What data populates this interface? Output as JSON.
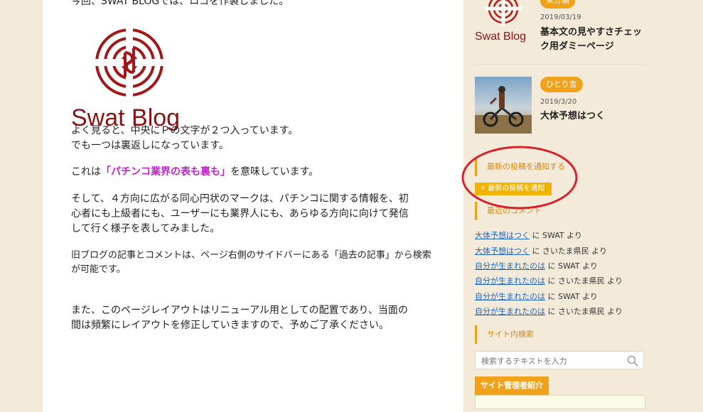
{
  "article": {
    "intro": "今回、SWAT BLOGでは、ロゴを作製しました。",
    "logo_text": "Swat Blog",
    "para1_line1": "よく見ると、中央にＰの文字が２つ入っています。",
    "para1_line2": "でも一つは裏返しになっています。",
    "para2_pre": "これは",
    "para2_highlight": "「パチンコ業界の表も裏も」",
    "para2_post": "を意味しています。",
    "para3_line1": "そして、４方向に広がる同心円状のマークは、パチンコに関する情報を、初",
    "para3_line2": "心者にも上級者にも、ユーザーにも業界人にも、あらゆる方向に向けて発信",
    "para3_line3": "して行く様子を表してみました。",
    "para4_line1": "旧ブログの記事とコメントは、ページ右側のサイドバーにある「過去の記事」から検索",
    "para4_line2": "が可能です。",
    "para5_line1": "また、このページレイアウトはリニューアル用としての配置であり、当面の",
    "para5_line2": "間は頻繁にレイアウトを修正していきますので、予めご了承ください。"
  },
  "sidebar": {
    "posts": [
      {
        "category": "未分類",
        "date": "2019/03/19",
        "title": "基本文の見やすさチェック用ダミーページ",
        "thumb_text": "Swat Blog"
      },
      {
        "category": "ひとり言",
        "date": "2019/3/20",
        "title": "大体予想はつく"
      }
    ],
    "notify_title": "最新の投稿を通知する",
    "notify_button": "最新の投稿を通知",
    "recent_comments_title": "最近のコメント",
    "comments": [
      {
        "link": "大体予想はつく",
        "text": "に SWAT より"
      },
      {
        "link": "大体予想はつく",
        "text": "に さいたま県民 より"
      },
      {
        "link": "自分が生まれたのは",
        "text": "に SWAT より"
      },
      {
        "link": "自分が生まれたのは",
        "text": "に さいたま県民 より"
      },
      {
        "link": "自分が生まれたのは",
        "text": "に SWAT より"
      },
      {
        "link": "自分が生まれたのは",
        "text": "に さいたま県民 より"
      }
    ],
    "search_title": "サイト内検索",
    "search_placeholder": "検索するテキストを入力",
    "admin_title": "サイト管理者紹介"
  },
  "colors": {
    "accent": "#f0a31a",
    "highlight": "#c21fd0",
    "link": "#1f66b8",
    "annotation": "#d8222a"
  }
}
